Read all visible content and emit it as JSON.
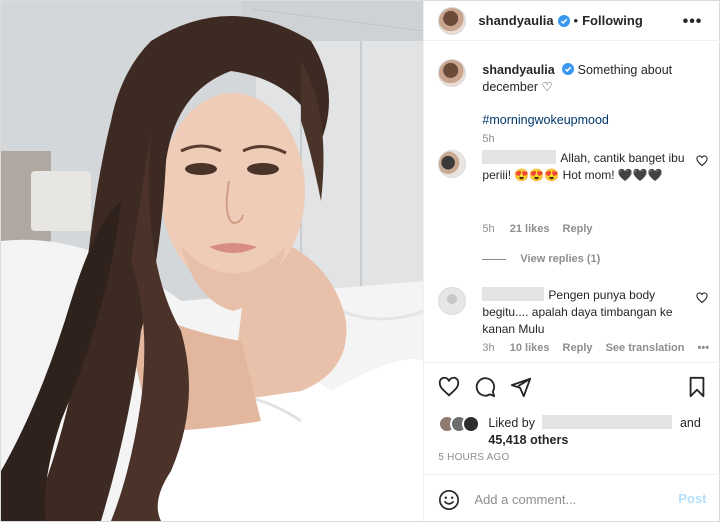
{
  "header": {
    "username": "shandyaulia",
    "separator": "•",
    "follow_status": "Following",
    "more_label": "•••"
  },
  "caption": {
    "username": "shandyaulia",
    "text": "Something about december ♡",
    "hashtag": "#morningwokeupmood",
    "time": "5h"
  },
  "comments": [
    {
      "text": "Allah, cantik banget ibu periii! 😍😍😍 Hot mom! 🖤🖤🖤",
      "time": "5h",
      "likes": "21 likes",
      "reply": "Reply"
    },
    {
      "text": "Pengen punya body begitu.... apalah daya timbangan ke kanan Mulu",
      "time": "3h",
      "likes": "10 likes",
      "reply": "Reply",
      "translate": "See translation",
      "more": "•••"
    }
  ],
  "view_replies": "View replies (1)",
  "likes": {
    "prefix": "Liked by",
    "suffix": "and",
    "others": "45,418 others"
  },
  "time_ago": "5 HOURS AGO",
  "add_comment": {
    "placeholder": "Add a comment...",
    "post_label": "Post"
  },
  "colors": {
    "verified": "#3897f0",
    "link": "#00376b",
    "muted": "#8e8e8e",
    "post_disabled": "#b2dffc"
  },
  "icons": [
    "verified-icon",
    "more-icon",
    "heart-icon",
    "comment-icon",
    "share-icon",
    "bookmark-icon",
    "emoji-icon"
  ]
}
